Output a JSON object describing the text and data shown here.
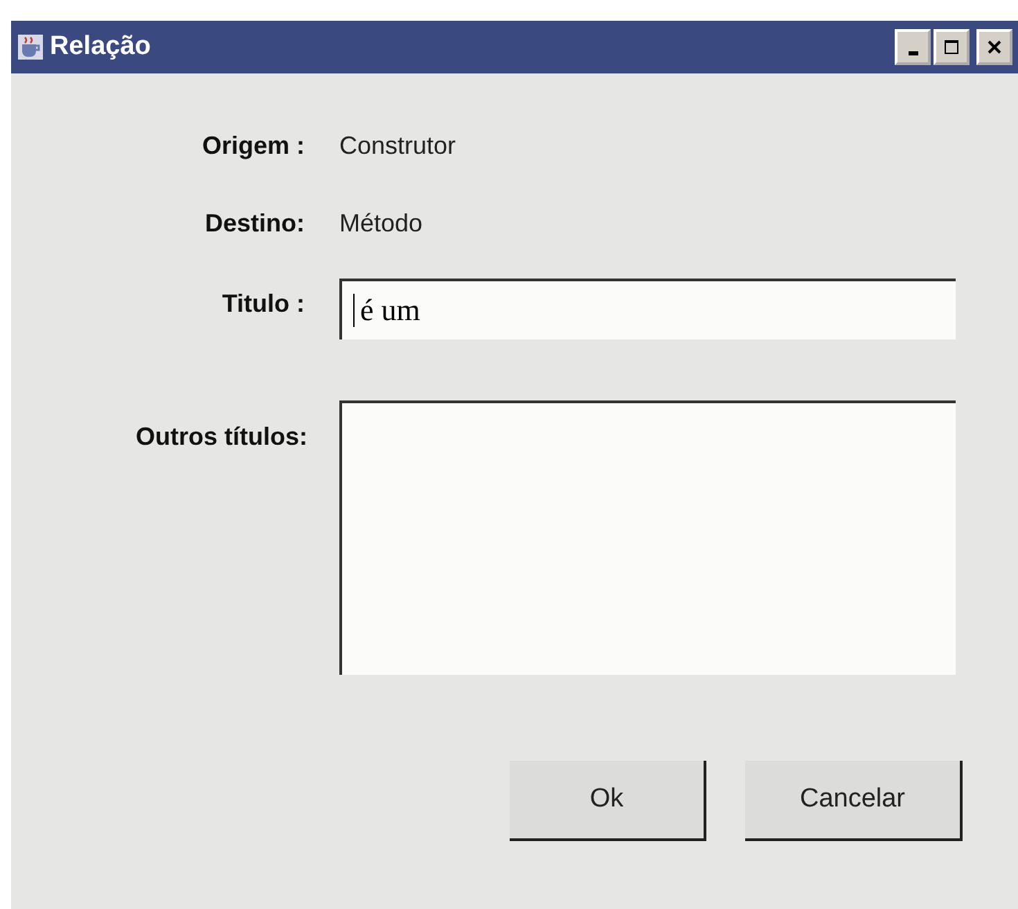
{
  "window": {
    "title": "Relação"
  },
  "fields": [
    {
      "label": "Origem :",
      "kind": "text",
      "value": "Construtor"
    },
    {
      "label": "Destino:",
      "kind": "text",
      "value": "Método"
    },
    {
      "label": "Titulo :",
      "kind": "input",
      "value": "é um"
    },
    {
      "label": "Outros títulos:",
      "kind": "textarea"
    }
  ],
  "buttons": [
    "Ok",
    "Cancelar"
  ]
}
